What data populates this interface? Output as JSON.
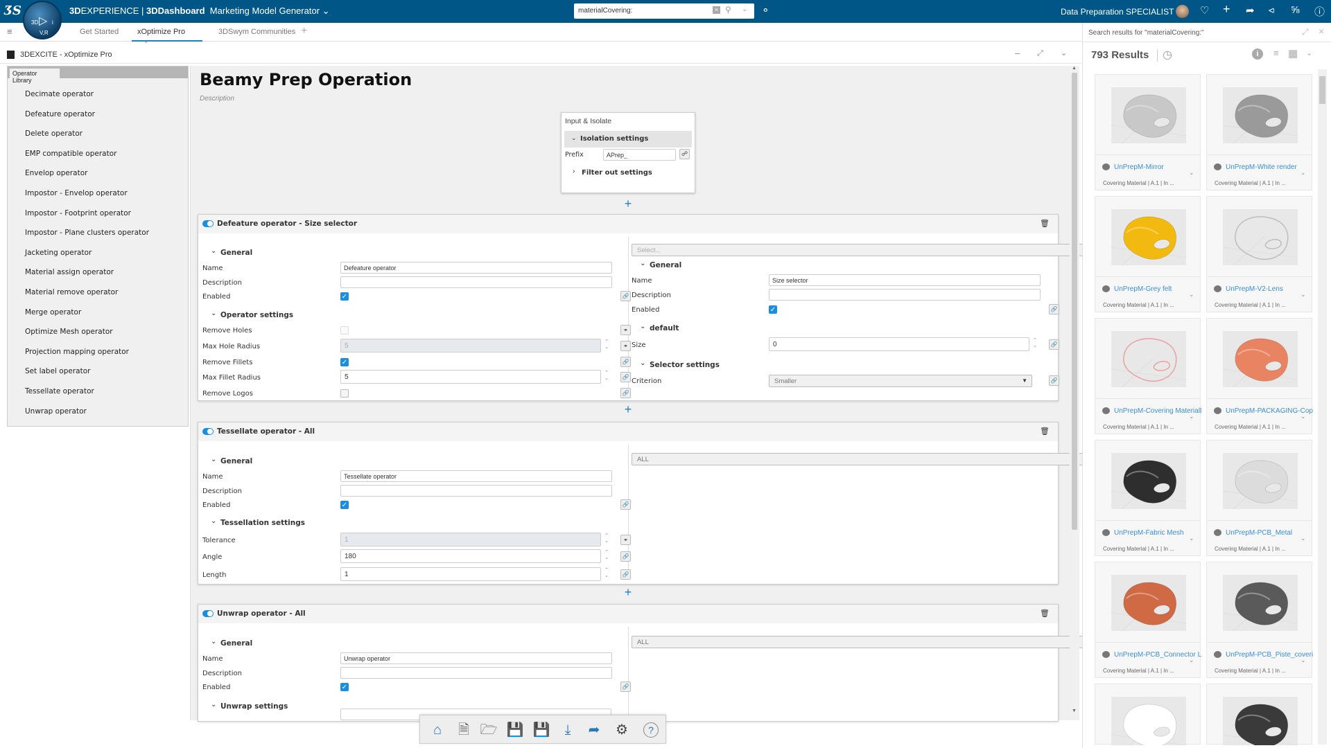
{
  "topbar": {
    "brand_bold": "3D",
    "brand": "EXPERIENCE | ",
    "app_bold": "3DDashboard",
    "dashboard": "Marketing Model Generator",
    "compass_labels": [
      "3D",
      "V,R",
      "i"
    ],
    "search_value": "materialCovering:",
    "user_role": "Data Preparation SPECIALIST",
    "icons": [
      "3ds-logo-icon",
      "compass-icon",
      "clear-icon",
      "search-icon",
      "chevron-down-icon",
      "tag-icon",
      "avatar",
      "notification-icon",
      "add-icon",
      "share-icon",
      "social-share-icon",
      "apps-icon",
      "help-icon"
    ]
  },
  "tabs": [
    {
      "label": "Get Started",
      "active": false
    },
    {
      "label": "xOptimize Pro",
      "active": true
    },
    {
      "label": "3DSwym Communities",
      "active": false
    }
  ],
  "panel": {
    "title": "3DEXCITE - xOptimize Pro"
  },
  "sidebar": {
    "tab": "Operator Library",
    "items": [
      "Decimate operator",
      "Defeature operator",
      "Delete operator",
      "EMP compatible operator",
      "Envelop operator",
      "Impostor - Envelop operator",
      "Impostor - Footprint operator",
      "Impostor - Plane clusters operator",
      "Jacketing operator",
      "Material assign operator",
      "Material remove operator",
      "Merge operator",
      "Optimize Mesh operator",
      "Projection mapping operator",
      "Set label operator",
      "Tessellate operator",
      "Unwrap operator"
    ]
  },
  "main": {
    "title": "Beamy Prep Operation",
    "description": "Description",
    "input_isolate": {
      "title": "Input & Isolate",
      "isolation": "Isolation settings",
      "prefix_label": "Prefix",
      "prefix_value": "APrep_",
      "filter": "Filter out settings"
    },
    "add_symbol": "+"
  },
  "cards": [
    {
      "title": "Defeature operator - Size selector",
      "enabled": true,
      "left": [
        {
          "type": "section",
          "label": "General"
        },
        {
          "type": "text",
          "label": "Name",
          "value": "Defeature operator"
        },
        {
          "type": "text",
          "label": "Description",
          "value": ""
        },
        {
          "type": "check",
          "label": "Enabled",
          "checked": true,
          "link": "link-icon"
        },
        {
          "type": "section",
          "label": "Operator settings"
        },
        {
          "type": "check",
          "label": "Remove Holes",
          "checked": false,
          "disabled": true,
          "link": "unlink-icon"
        },
        {
          "type": "number",
          "label": "Max Hole Radius",
          "value": "5",
          "disabled": true,
          "link": "unlink-icon"
        },
        {
          "type": "check",
          "label": "Remove Fillets",
          "checked": true,
          "link": "link-icon"
        },
        {
          "type": "number",
          "label": "Max Fillet Radius",
          "value": "5",
          "link": "link-icon"
        },
        {
          "type": "check",
          "label": "Remove Logos",
          "checked": false,
          "link": "link-icon"
        }
      ],
      "right_select": "Select...",
      "right": [
        {
          "type": "section",
          "label": "General"
        },
        {
          "type": "text",
          "label": "Name",
          "value": "Size selector"
        },
        {
          "type": "text",
          "label": "Description",
          "value": ""
        },
        {
          "type": "check",
          "label": "Enabled",
          "checked": true,
          "link": "link-icon"
        },
        {
          "type": "section",
          "label": "default"
        },
        {
          "type": "number",
          "label": "Size",
          "value": "0",
          "link": "link-icon"
        },
        {
          "type": "section",
          "label": "Selector settings"
        },
        {
          "type": "select",
          "label": "Criterion",
          "value": "Smaller",
          "link": "link-icon"
        }
      ]
    },
    {
      "title": "Tessellate operator - All",
      "enabled": true,
      "left": [
        {
          "type": "section",
          "label": "General"
        },
        {
          "type": "text",
          "label": "Name",
          "value": "Tessellate operator"
        },
        {
          "type": "text",
          "label": "Description",
          "value": ""
        },
        {
          "type": "check",
          "label": "Enabled",
          "checked": true,
          "link": "link-icon"
        },
        {
          "type": "section",
          "label": "Tessellation settings"
        },
        {
          "type": "number",
          "label": "Tolerance",
          "value": "1",
          "disabled": true,
          "link": "unlink-icon"
        },
        {
          "type": "number",
          "label": "Angle",
          "value": "180",
          "link": "link-icon"
        },
        {
          "type": "number",
          "label": "Length",
          "value": "1",
          "link": "link-icon"
        }
      ],
      "right_select": "ALL",
      "right": []
    },
    {
      "title": "Unwrap operator - All",
      "enabled": true,
      "left": [
        {
          "type": "section",
          "label": "General"
        },
        {
          "type": "text",
          "label": "Name",
          "value": "Unwrap operator"
        },
        {
          "type": "text",
          "label": "Description",
          "value": ""
        },
        {
          "type": "check",
          "label": "Enabled",
          "checked": true,
          "link": "link-icon"
        },
        {
          "type": "section",
          "label": "Unwrap settings"
        }
      ],
      "right_select": "ALL",
      "right": []
    }
  ],
  "toolbar": {
    "icons": [
      "home-icon",
      "new-file-icon",
      "open-folder-icon",
      "save-icon",
      "save-as-icon",
      "download-icon",
      "share-arrow-icon",
      "settings-icon",
      "help-icon"
    ]
  },
  "search_panel": {
    "header": "Search results for \"materialCovering:\"",
    "count": "793",
    "results_label": "Results",
    "results": [
      {
        "name": "UnPrepM-Mirror",
        "subtitle": "Covering Material | A.1 | In ...",
        "color": "#c8c8c8",
        "style": "solid"
      },
      {
        "name": "UnPrepM-White render",
        "subtitle": "Covering Material | A.1 | In ...",
        "color": "#9a9a9a",
        "style": "solid"
      },
      {
        "name": "UnPrepM-Grey felt",
        "subtitle": "Covering Material | A.1 | In ...",
        "color": "#f2b90f",
        "style": "solid"
      },
      {
        "name": "UnPrepM-V2-Lens",
        "subtitle": "Covering Material | A.1 | In ...",
        "color": "#bdbdbd",
        "style": "wire"
      },
      {
        "name": "UnPrepM-Covering MaterialDD",
        "subtitle": "Covering Material | A.1 | In ...",
        "color": "#eaa0a0",
        "style": "wire"
      },
      {
        "name": "UnPrepM-PACKAGING-Copper",
        "subtitle": "Covering Material | A.1 | In ...",
        "color": "#e88462",
        "style": "solid"
      },
      {
        "name": "UnPrepM-Fabric Mesh",
        "subtitle": "Covering Material | A.1 | In ...",
        "color": "#2e2e2e",
        "style": "solid"
      },
      {
        "name": "UnPrepM-PCB_Metal",
        "subtitle": "Covering Material | A.1 | In ...",
        "color": "#dcdcdc",
        "style": "solid"
      },
      {
        "name": "UnPrepM-PCB_Connector Lo",
        "subtitle": "Covering Material | A.1 | In ...",
        "color": "#d06a45",
        "style": "solid"
      },
      {
        "name": "UnPrepM-PCB_Piste_covering",
        "subtitle": "Covering Material | A.1 | In ...",
        "color": "#5a5a5a",
        "style": "solid"
      },
      {
        "name": "",
        "subtitle": "",
        "color": "#ffffff",
        "style": "solid"
      },
      {
        "name": "",
        "subtitle": "",
        "color": "#3a3a3a",
        "style": "solid"
      }
    ]
  }
}
